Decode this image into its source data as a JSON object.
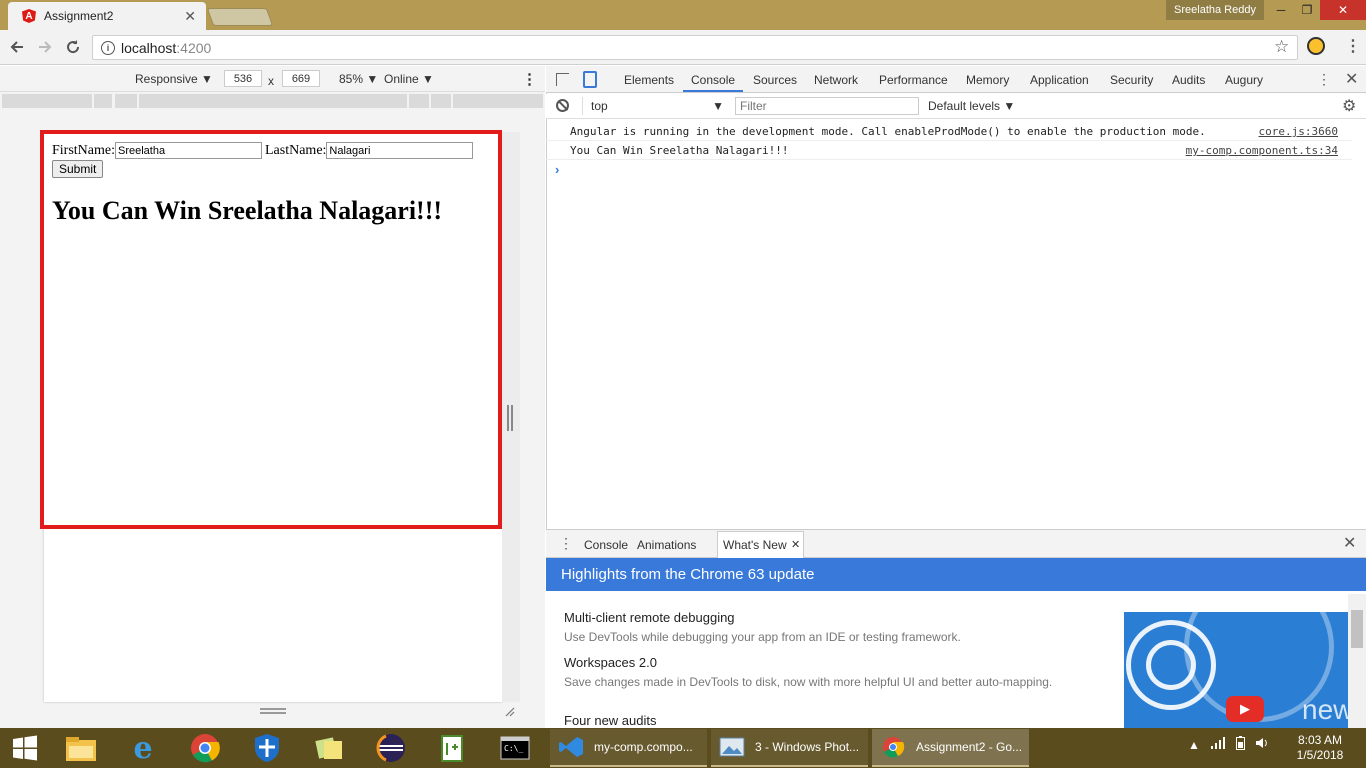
{
  "browser": {
    "tab_title": "Assignment2",
    "tab_close": "✕",
    "favicon_letter": "A",
    "user_name": "Sreelatha Reddy",
    "url_host": "localhost",
    "url_port": ":4200",
    "window_controls": {
      "minimize": "─",
      "maximize": "❐",
      "close": "✕"
    },
    "icons": [
      "back-arrow",
      "forward-arrow",
      "reload",
      "info",
      "star",
      "extension",
      "menu"
    ]
  },
  "device_toolbar": {
    "device": "Responsive ▼",
    "width": "536",
    "times": "x",
    "height": "669",
    "zoom": "85% ▼",
    "network": "Online ▼",
    "more": "⋮"
  },
  "page": {
    "firstname_label": "FirstName:",
    "firstname_value": "Sreelatha",
    "lastname_label": "LastName:",
    "lastname_value": "Nalagari",
    "submit_label": "Submit",
    "greeting": "You Can Win Sreelatha Nalagari!!!",
    "frame_color": "#e21b1b"
  },
  "devtools": {
    "tabs": [
      "Elements",
      "Console",
      "Sources",
      "Network",
      "Performance",
      "Memory",
      "Application",
      "Security",
      "Audits",
      "Augury"
    ],
    "active_tab": "Console",
    "context": "top",
    "context_arrow": "▼",
    "filter_placeholder": "Filter",
    "levels": "Default levels ▼",
    "logs": [
      {
        "message": "Angular is running in the development mode. Call enableProdMode() to enable the production mode.",
        "source": "core.js:3660"
      },
      {
        "message": "You Can Win Sreelatha Nalagari!!!",
        "source": "my-comp.component.ts:34"
      }
    ],
    "prompt": "›",
    "accent": "#3879d9"
  },
  "drawer": {
    "tabs": [
      "Console",
      "Animations",
      "What's New"
    ],
    "active_tab": "What's New",
    "tab_close": "✕",
    "banner": "Highlights from the Chrome 63 update",
    "items": [
      {
        "title": "Multi-client remote debugging",
        "desc": "Use DevTools while debugging your app from an IDE or testing framework."
      },
      {
        "title": "Workspaces 2.0",
        "desc": "Save changes made in DevTools to disk, now with more helpful UI and better auto-mapping."
      },
      {
        "title": "Four new audits",
        "desc": ""
      }
    ],
    "image_text": "new"
  },
  "taskbar": {
    "apps": [
      {
        "label": "my-comp.compo...",
        "icon": "vscode-icon"
      },
      {
        "label": "3 - Windows Phot...",
        "icon": "photos-icon"
      },
      {
        "label": "Assignment2 - Go...",
        "icon": "chrome-icon"
      }
    ],
    "time": "8:03 AM",
    "date": "1/5/2018"
  }
}
